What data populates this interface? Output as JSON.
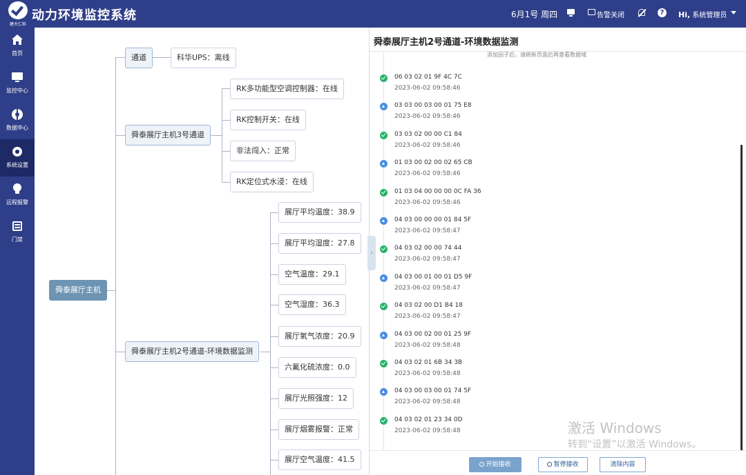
{
  "header": {
    "logo_text": "建大仁科",
    "app_title": "动力环境监控系统",
    "date": "6月1号 周四",
    "alarm_close_label": "告警关闭",
    "user_hi": "Hi,",
    "user_name": "系统管理员"
  },
  "sidebar": {
    "items": [
      {
        "label": "首页",
        "icon": "home-icon"
      },
      {
        "label": "监控中心",
        "icon": "monitor-icon"
      },
      {
        "label": "数据中心",
        "icon": "data-icon"
      },
      {
        "label": "系统设置",
        "icon": "gear-icon",
        "active": true
      },
      {
        "label": "远程报警",
        "icon": "bulb-icon"
      },
      {
        "label": "门禁",
        "icon": "door-icon"
      }
    ]
  },
  "tree": {
    "root": "舜泰展厅主机",
    "branches": [
      {
        "label": "通道",
        "children": [
          "科华UPS：离线"
        ]
      },
      {
        "label": "舜泰展厅主机3号通道",
        "children": [
          "RK多功能型空调控制器：在线",
          "RK控制开关：在线",
          "非法闯入：正常",
          "RK定位式水浸：在线"
        ]
      },
      {
        "label": "舜泰展厅主机2号通道-环境数据监测",
        "children": [
          "展厅平均温度：38.9",
          "展厅平均湿度：27.8",
          "空气温度：29.1",
          "空气湿度：36.3",
          "展厅氧气浓度：20.9",
          "六氟化硫浓度：0.0",
          "展厅光照强度：12",
          "展厅烟雾报警：正常",
          "展厅空气温度：41.5"
        ]
      }
    ]
  },
  "panel": {
    "title": "舜泰展厅主机2号通道-环境数据监测",
    "hint": "添加因子后，请刷新页面后再查看数据域",
    "log": [
      {
        "hex": "06 03 02 01 9F 4C 7C",
        "time": "2023-06-02 09:58:46",
        "dir": "recv"
      },
      {
        "hex": "03 03 00 03 00 01 75 E8",
        "time": "2023-06-02 09:58:46",
        "dir": "send"
      },
      {
        "hex": "03 03 02 00 00 C1 84",
        "time": "2023-06-02 09:58:46",
        "dir": "recv"
      },
      {
        "hex": "01 03 00 02 00 02 65 CB",
        "time": "2023-06-02 09:58:46",
        "dir": "send"
      },
      {
        "hex": "01 03 04 00 00 00 0C FA 36",
        "time": "2023-06-02 09:58:46",
        "dir": "recv"
      },
      {
        "hex": "04 03 00 00 00 01 84 5F",
        "time": "2023-06-02 09:58:47",
        "dir": "send"
      },
      {
        "hex": "04 03 02 00 00 74 44",
        "time": "2023-06-02 09:58:47",
        "dir": "recv"
      },
      {
        "hex": "04 03 00 01 00 01 D5 9F",
        "time": "2023-06-02 09:58:47",
        "dir": "send"
      },
      {
        "hex": "04 03 02 00 D1 B4 18",
        "time": "2023-06-02 09:58:47",
        "dir": "recv"
      },
      {
        "hex": "04 03 00 02 00 01 25 9F",
        "time": "2023-06-02 09:58:48",
        "dir": "send"
      },
      {
        "hex": "04 03 02 01 6B 34 3B",
        "time": "2023-06-02 09:58:48",
        "dir": "recv"
      },
      {
        "hex": "04 03 00 03 00 01 74 5F",
        "time": "2023-06-02 09:58:48",
        "dir": "send"
      },
      {
        "hex": "04 03 02 01 23 34 0D",
        "time": "2023-06-02 09:58:48",
        "dir": "recv"
      }
    ],
    "buttons": {
      "start": "开始接收",
      "pause": "暂停接收",
      "clear": "清除内容"
    }
  },
  "watermark": {
    "title": "激活 Windows",
    "subtitle": "转到“设置”以激活 Windows。"
  },
  "colors": {
    "header_bg": "#2e3e88",
    "sidebar_active": "#1e2a66",
    "root_node": "#6d94b3",
    "recv_dot": "#27b26b",
    "send_dot": "#4a8ee0"
  }
}
